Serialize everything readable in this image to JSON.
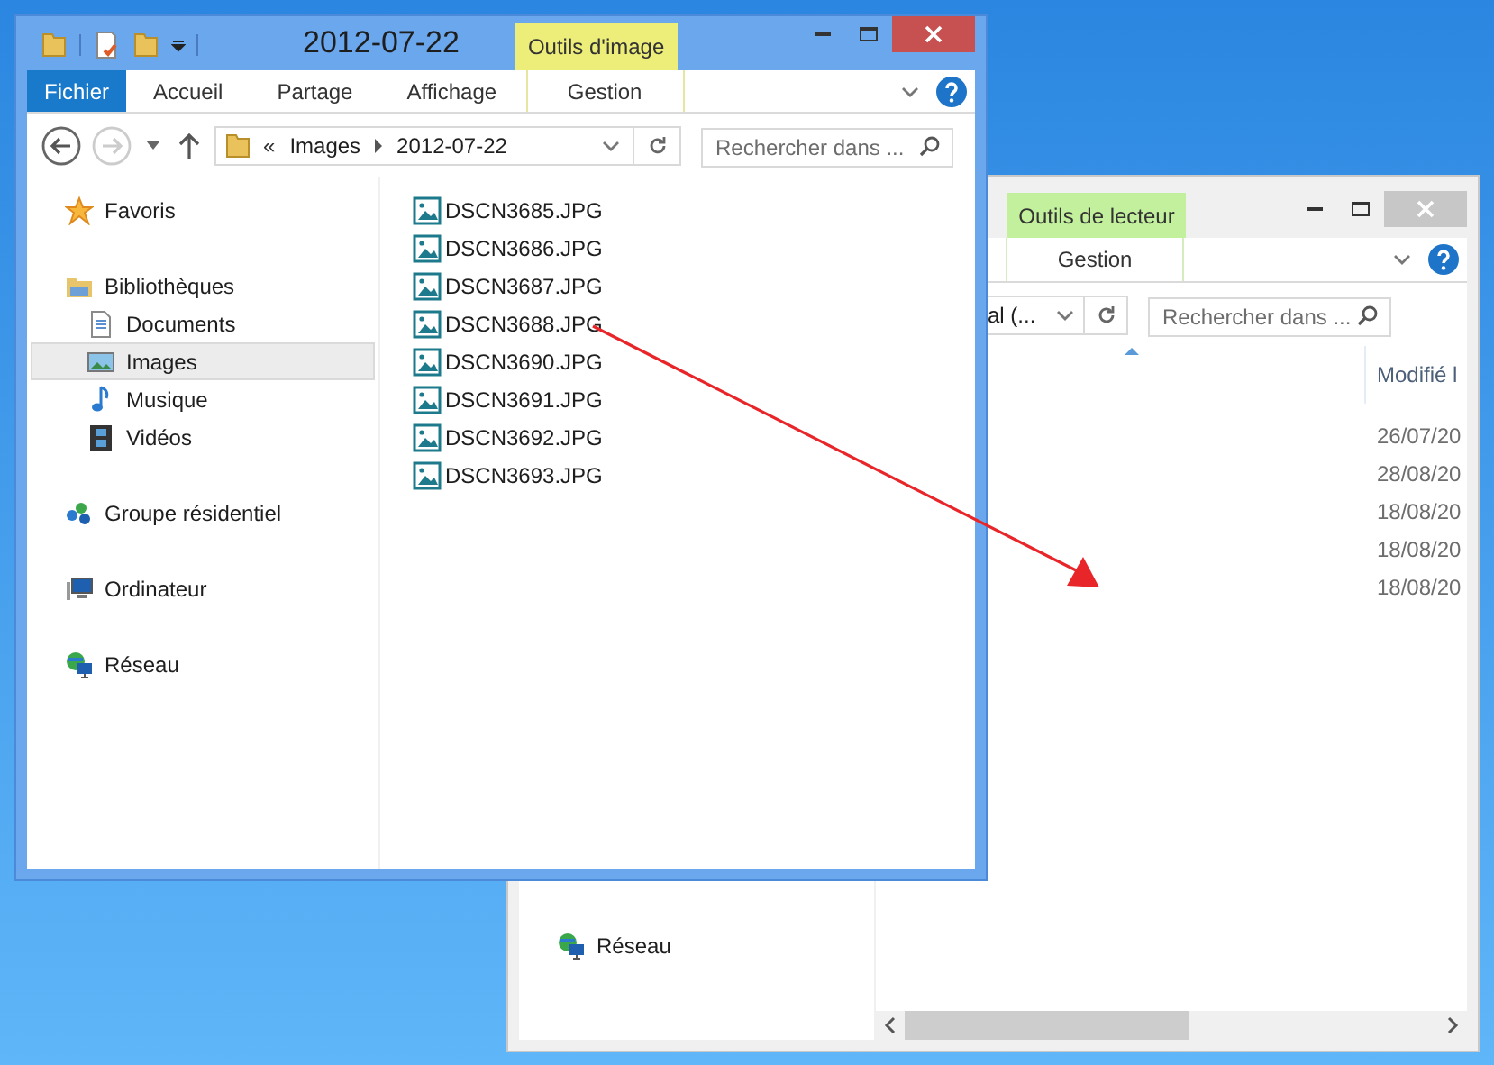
{
  "front_window": {
    "title": "2012-07-22",
    "context_tab": "Outils d'image",
    "ribbon_tabs": [
      {
        "label": "Fichier",
        "kind": "file",
        "selected": false
      },
      {
        "label": "Accueil",
        "kind": "tab",
        "selected": false
      },
      {
        "label": "Partage",
        "kind": "tab",
        "selected": false
      },
      {
        "label": "Affichage",
        "kind": "tab",
        "selected": false
      },
      {
        "label": "Gestion",
        "kind": "context",
        "selected": false
      }
    ],
    "address": {
      "overflow": "«",
      "segments": [
        "Images",
        "2012-07-22"
      ]
    },
    "search": {
      "placeholder": "Rechercher dans ..."
    },
    "nav": [
      {
        "label": "Favoris",
        "kind": "star",
        "selected": false
      },
      {
        "label": "Bibliothèques",
        "kind": "library",
        "selected": false,
        "children": [
          {
            "label": "Documents",
            "kind": "document",
            "selected": false
          },
          {
            "label": "Images",
            "kind": "pictures",
            "selected": true
          },
          {
            "label": "Musique",
            "kind": "music",
            "selected": false
          },
          {
            "label": "Vidéos",
            "kind": "videos",
            "selected": false
          }
        ]
      },
      {
        "label": "Groupe résidentiel",
        "kind": "homegroup",
        "selected": false
      },
      {
        "label": "Ordinateur",
        "kind": "computer",
        "selected": false
      },
      {
        "label": "Réseau",
        "kind": "network",
        "selected": false
      }
    ],
    "files": [
      "DSCN3685.JPG",
      "DSCN3686.JPG",
      "DSCN3687.JPG",
      "DSCN3688.JPG",
      "DSCN3690.JPG",
      "DSCN3691.JPG",
      "DSCN3692.JPG",
      "DSCN3693.JPG"
    ]
  },
  "back_window": {
    "context_tab": "Outils de lecteur",
    "ribbon_tab": "Gestion",
    "address": "al (...",
    "search": {
      "placeholder": "Rechercher dans ..."
    },
    "column_header": "Modifié l",
    "dates": [
      "26/07/20",
      "28/08/20",
      "18/08/20",
      "18/08/20",
      "18/08/20"
    ],
    "nav": [
      {
        "label": "Réseau",
        "kind": "network",
        "selected": false
      }
    ]
  }
}
